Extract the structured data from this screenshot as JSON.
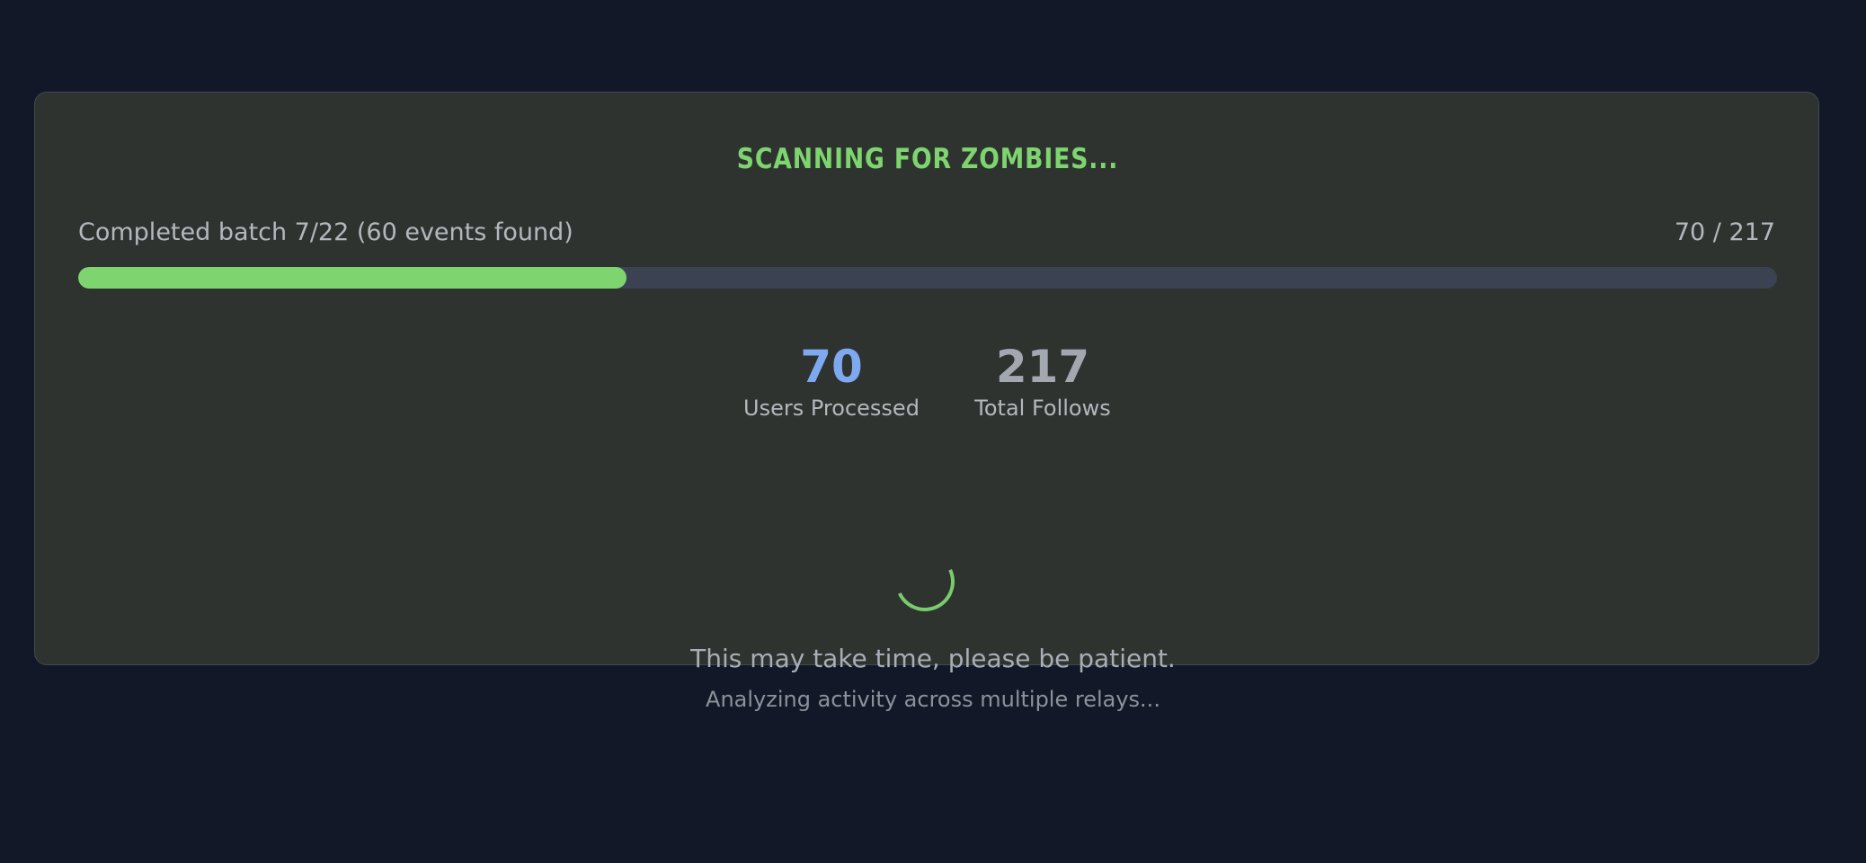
{
  "scan": {
    "title": "SCANNING FOR ZOMBIES...",
    "batch_status": "Completed batch 7/22 (60 events found)",
    "progress_text": "70 / 217",
    "progress_fraction": 0.3226,
    "accent_color": "#7ed56f"
  },
  "stats": {
    "users_processed_value": "70",
    "users_processed_label": "Users Processed",
    "total_follows_value": "217",
    "total_follows_label": "Total Follows"
  },
  "footer": {
    "patience_message": "This may take time, please be patient.",
    "analyzing_message": "Analyzing activity across multiple relays..."
  },
  "icons": {
    "spinner": "loading-spinner-icon"
  },
  "colors": {
    "background": "#121827",
    "card": "#2e3330",
    "progress_track": "#3b4252",
    "users_value": "#7ea8ef"
  }
}
